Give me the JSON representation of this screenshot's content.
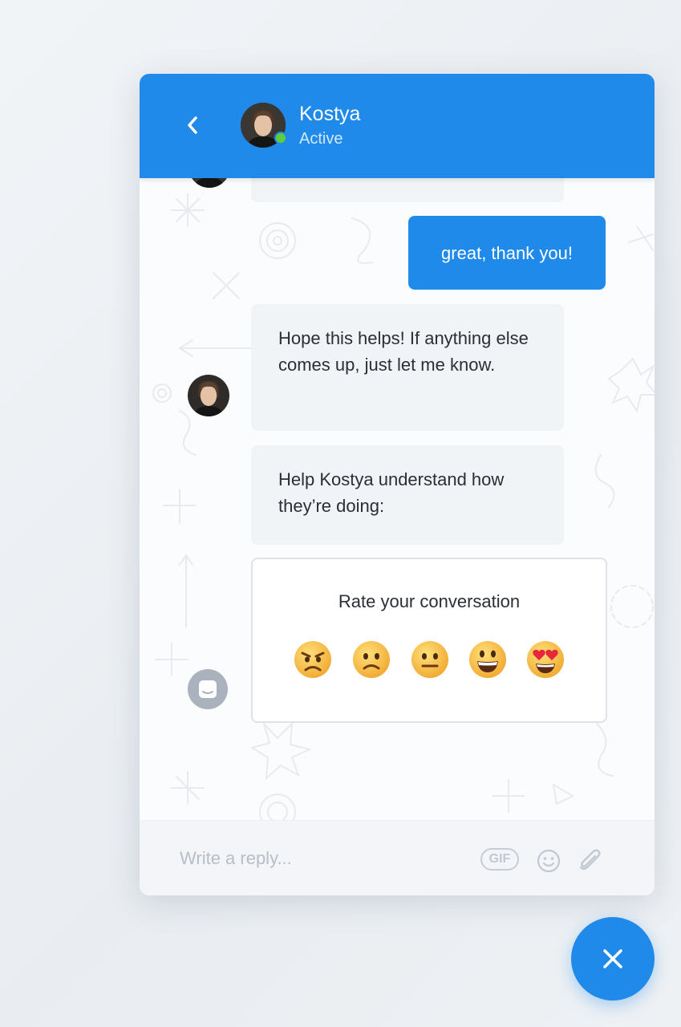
{
  "header": {
    "name": "Kostya",
    "status": "Active"
  },
  "messages": [
    {
      "from": "admin",
      "text": ""
    },
    {
      "from": "user",
      "text": "great, thank you!"
    },
    {
      "from": "admin",
      "text": "Hope this helps! If anything else comes up, just let me know."
    },
    {
      "from": "admin",
      "text": "Help Kostya understand how they’re doing:"
    }
  ],
  "rating": {
    "title": "Rate your conversation",
    "options": [
      "angry-face",
      "slightly-frowning-face",
      "neutral-face",
      "grinning-face",
      "heart-eyes-face"
    ]
  },
  "composer": {
    "placeholder": "Write a reply...",
    "gif_label": "GIF"
  },
  "colors": {
    "brand": "#208aeb",
    "online": "#5ecf3a",
    "admin_bubble": "#f1f4f7"
  }
}
